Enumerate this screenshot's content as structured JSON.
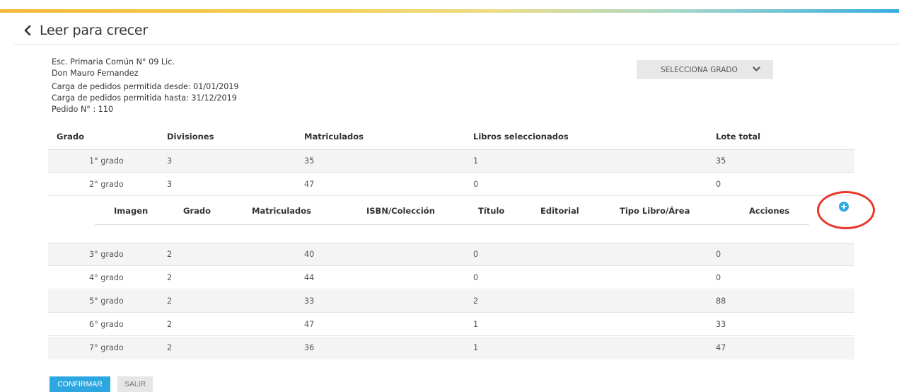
{
  "header": {
    "title": "Leer para crecer"
  },
  "school": {
    "line1": "Esc. Primaria Común N° 09 Lic.",
    "line2": "Don Mauro Fernandez",
    "allowed_from": "Carga de pedidos permitida desde: 01/01/2019",
    "allowed_until": "Carga de pedidos permitida hasta: 31/12/2019",
    "order": "Pedido N° : 110"
  },
  "grade_select": {
    "label": "SELECCIONA GRADO"
  },
  "table": {
    "headers": {
      "grado": "Grado",
      "divisiones": "Divisiones",
      "matriculados": "Matriculados",
      "libros": "Libros seleccionados",
      "lote": "Lote total"
    },
    "rows": [
      {
        "grado": "1° grado",
        "divisiones": "3",
        "matriculados": "35",
        "libros": "1",
        "lote": "35"
      },
      {
        "grado": "2° grado",
        "divisiones": "3",
        "matriculados": "47",
        "libros": "0",
        "lote": "0"
      },
      {
        "grado": "3° grado",
        "divisiones": "2",
        "matriculados": "40",
        "libros": "0",
        "lote": "0"
      },
      {
        "grado": "4° grado",
        "divisiones": "2",
        "matriculados": "44",
        "libros": "0",
        "lote": "0"
      },
      {
        "grado": "5° grado",
        "divisiones": "2",
        "matriculados": "33",
        "libros": "2",
        "lote": "88"
      },
      {
        "grado": "6° grado",
        "divisiones": "2",
        "matriculados": "47",
        "libros": "1",
        "lote": "33"
      },
      {
        "grado": "7° grado",
        "divisiones": "2",
        "matriculados": "36",
        "libros": "1",
        "lote": "47"
      }
    ]
  },
  "subtable": {
    "headers": {
      "imagen": "Imagen",
      "grado": "Grado",
      "matriculados": "Matriculados",
      "isbn": "ISBN/Colección",
      "titulo": "Título",
      "editorial": "Editorial",
      "tipo": "Tipo Libro/Área",
      "acciones": "Acciones"
    }
  },
  "buttons": {
    "confirm": "CONFIRMAR",
    "exit": "SALIR"
  },
  "colors": {
    "accent": "#2ea7e0",
    "highlight": "#e8392c"
  }
}
